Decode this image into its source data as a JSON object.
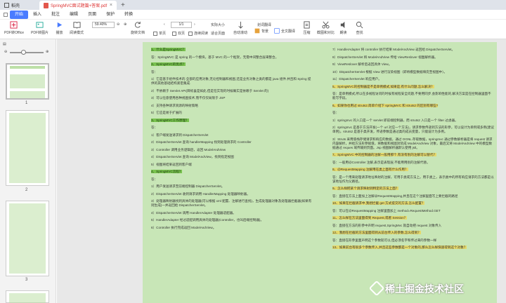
{
  "tabs": {
    "home": "稻壳",
    "doc": "SpringMVC面试题篇+答案.pdf"
  },
  "menu": [
    "开始",
    "插入",
    "批注",
    "编辑",
    "页面",
    "保护",
    "转换"
  ],
  "toolbar": {
    "big": [
      "PDF转Office",
      "PDF转图片",
      "播放",
      "阅读模式",
      "旋转文档",
      "单页",
      "双页",
      "连续阅读",
      "自动滚动",
      "背景",
      "全文翻译",
      "压缩",
      "截图和对比",
      "朗读",
      "查找"
    ],
    "zoom": "59.40%",
    "page": "1",
    "page_total": "/1",
    "small": [
      "划词翻译",
      "实际大小",
      "适合页面"
    ]
  },
  "sidebar": {
    "pages": [
      "1",
      "2",
      "3"
    ]
  },
  "pdf": {
    "left": [
      {
        "t": "q",
        "text": "1、什么是SpringMVC？"
      },
      {
        "t": "p",
        "text": "答：SpringMVC 是 spring 的一个模块，基于 MVC 的一个框架，无需中间整合层来整合。"
      },
      {
        "t": "q",
        "text": "2、SpringMVC的优点？"
      },
      {
        "t": "p",
        "text": "答："
      },
      {
        "t": "p",
        "text": "1）它是基于组件技术的.全部的应用对象,无论控制器和视图,还是业务对象之类的都是 java 组件.并且和 Spring 提供的其他基础结构紧密集成."
      },
      {
        "t": "p",
        "text": "2）不依赖于 Servlet API(目标虽是如此,但是在实现的时候确实是依赖于 Servlet 的)"
      },
      {
        "t": "p",
        "text": "3）可以任意使用各种视图技术,而不仅仅局限于 JSP"
      },
      {
        "t": "p",
        "text": "4）支持各种请求资源的映射策略"
      },
      {
        "t": "p",
        "text": "5）它应是易于扩展的"
      },
      {
        "t": "q",
        "text": "3、SpringMVC工作原理？"
      },
      {
        "t": "p",
        "text": "答："
      },
      {
        "t": "p",
        "text": "1）客户端发送请求到 DispatcherServlet"
      },
      {
        "t": "p",
        "text": "2）DispatcherServlet 查询 handlerMapping 找到处理请求的 Controller"
      },
      {
        "t": "p",
        "text": "3）Controller 调用业务逻辑后，返回 ModelAndView"
      },
      {
        "t": "p",
        "text": "4）DispatcherServlet 查询 ModelAndView，找到指定视图"
      },
      {
        "t": "p",
        "text": "5）视图将结果返回到客户端"
      },
      {
        "t": "q",
        "text": "4、SpringMVC流程？"
      },
      {
        "t": "p",
        "text": "答："
      },
      {
        "t": "p",
        "text": "1）用户发送请求至前端控制器 DispatcherServlet。"
      },
      {
        "t": "p",
        "text": "2）DispatcherServlet 收到请求调用 HandlerMapping 处理器映射器。"
      },
      {
        "t": "p",
        "text": "3）处理器映射器找到具体的处理器(可以根据 xml 配置、注解进行查找)，生成处理器对象及处理器拦截器(如果有则生成)一并返回给 DispatcherServlet。"
      },
      {
        "t": "p",
        "text": "4）DispatcherServlet 调用 HandlerAdapter 处理器适配器。"
      },
      {
        "t": "p",
        "text": "5）HandlerAdapter 经过适配调用具体的处理器(Controller，也叫后端控制器)。"
      },
      {
        "t": "p",
        "text": "6）Controller 执行完成返回 ModelAndView。"
      }
    ],
    "right": [
      {
        "t": "p",
        "text": "7）HandlerAdapter 将 controller 执行结果 ModelAndView 返回给 DispatcherServlet。"
      },
      {
        "t": "p",
        "text": "8）DispatcherServlet 将 ModelAndView 传给 ViewReslover 视图解析器。"
      },
      {
        "t": "p",
        "text": "9）ViewReslover 解析后返回具体 View。"
      },
      {
        "t": "p",
        "text": "10）DispatcherServlet 根据 View 进行渲染视图（即将模型数据填充至视图中）。"
      },
      {
        "t": "p",
        "text": "11）DispatcherServlet 响应用户。"
      },
      {
        "t": "q",
        "text": "5、SpringMVC的控制器是不是单例模式,如果是,有什么问题,怎么解决？"
      },
      {
        "t": "p",
        "text": "答：是单例模式,所以在多线程访问的时候有线程安全问题,不要用同步,会影响性能的,解决方案是在控制器里面不能写字段。"
      },
      {
        "t": "q",
        "text": "6、如果你也用过 struts2.简单介绍下 springMVC 和 struts2 的区别有哪些?"
      },
      {
        "t": "p",
        "text": "答："
      },
      {
        "t": "p",
        "text": "1）springmvc 的入口是一个 servlet 即前端控制器，而 struts2 入口是一个 filter 过虑器。"
      },
      {
        "t": "p",
        "text": "2）springmvc 是基于方法开发(一个 url 对应一个方法)，请求参数传递到方法的形参，可以设计为单例或多例(建议单例)，struts2 是基于类开发，传递参数是通过类的成员变量，只能设计为多例。"
      },
      {
        "t": "p",
        "text": "3）Struts 采用值栈存储请求和响应的数据，通过 OGNL 存取数据，springmvc 通过参数解析器是将 request 请求内容解析，并给方法形参赋值，将数据和视图封装成 ModelAndView 对象，最后又将 ModelAndView 中的模型数据通过 reques 域传输到页面。Jsp 视图解析器默认使用 jstl。"
      },
      {
        "t": "q",
        "text": "7、SpringMVC 中的控制器的注解一般用那个,有没有别的注解可以替代？"
      },
      {
        "t": "p",
        "text": "答：一般用@Controller 注解,表示是表现层,不能用用别的注解代替。"
      },
      {
        "t": "q",
        "text": "8、@RequestMapping 注解用在类上面有什么作用？"
      },
      {
        "t": "p",
        "text": "答：是一个用来处理请求地址映射的注解，可用于类或方法上。用于类上，表示类中的所有响应请求的方法都是以该地址作为父路径。"
      },
      {
        "t": "q",
        "text": "9、怎么样把某个请求映射到特定的方法上面？"
      },
      {
        "t": "p",
        "text": "答：直接在方法上面加上注解@RequestMapping,并且在这个注解里面写上要拦截的路径"
      },
      {
        "t": "q",
        "text": "10、如果在拦截请求中,我想拦截 get 方式提交的方法,怎么配置？"
      },
      {
        "t": "p",
        "text": "答：可以在@RequestMapping 注解里面加上 method=RequestMethod.GET"
      },
      {
        "t": "q",
        "text": "11、怎么样在方法里面得到 Request,或者 Session？"
      },
      {
        "t": "p",
        "text": "答：直接在方法的形参中声明 request,SpringMvc 就自动把 request 对象传入"
      },
      {
        "t": "q",
        "text": "12、我想在拦截的方法里面得到从前台传入的参数,怎么得到？"
      },
      {
        "t": "p",
        "text": "答：直接在形参里面声明这个参数就可以,但必须名字和传过来的参数一样"
      },
      {
        "t": "q",
        "text": "13、如果前台有很多个参数传入,并且这些参数都是一个对象的,那么怎么样快速得到这个对象？"
      }
    ]
  },
  "watermark": "稀土掘金技术社区",
  "colors": {
    "page_bg": "#c8e6b7",
    "highlight": "#e5d96b",
    "section": "#79c24f",
    "accent": "#4a7cff"
  }
}
